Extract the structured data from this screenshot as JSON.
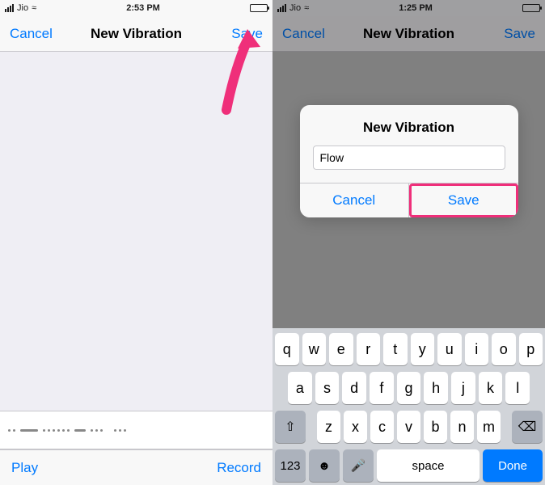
{
  "left": {
    "status": {
      "carrier": "Jio",
      "wifi": "≈",
      "time": "2:53 PM"
    },
    "nav": {
      "cancel": "Cancel",
      "title": "New Vibration",
      "save": "Save"
    },
    "toolbar": {
      "play": "Play",
      "record": "Record"
    }
  },
  "right": {
    "status": {
      "carrier": "Jio",
      "wifi": "≈",
      "time": "1:25 PM"
    },
    "nav": {
      "cancel": "Cancel",
      "title": "New Vibration",
      "save": "Save"
    },
    "modal": {
      "title": "New Vibration",
      "value": "Flow",
      "cancel": "Cancel",
      "save": "Save"
    },
    "keyboard": {
      "row1": [
        "q",
        "w",
        "e",
        "r",
        "t",
        "y",
        "u",
        "i",
        "o",
        "p"
      ],
      "row2": [
        "a",
        "s",
        "d",
        "f",
        "g",
        "h",
        "j",
        "k",
        "l"
      ],
      "row3": [
        "z",
        "x",
        "c",
        "v",
        "b",
        "n",
        "m"
      ],
      "shift": "⇧",
      "backspace": "⌫",
      "num": "123",
      "emoji": "😀",
      "mic": "🎤",
      "space": "space",
      "done": "Done"
    }
  }
}
